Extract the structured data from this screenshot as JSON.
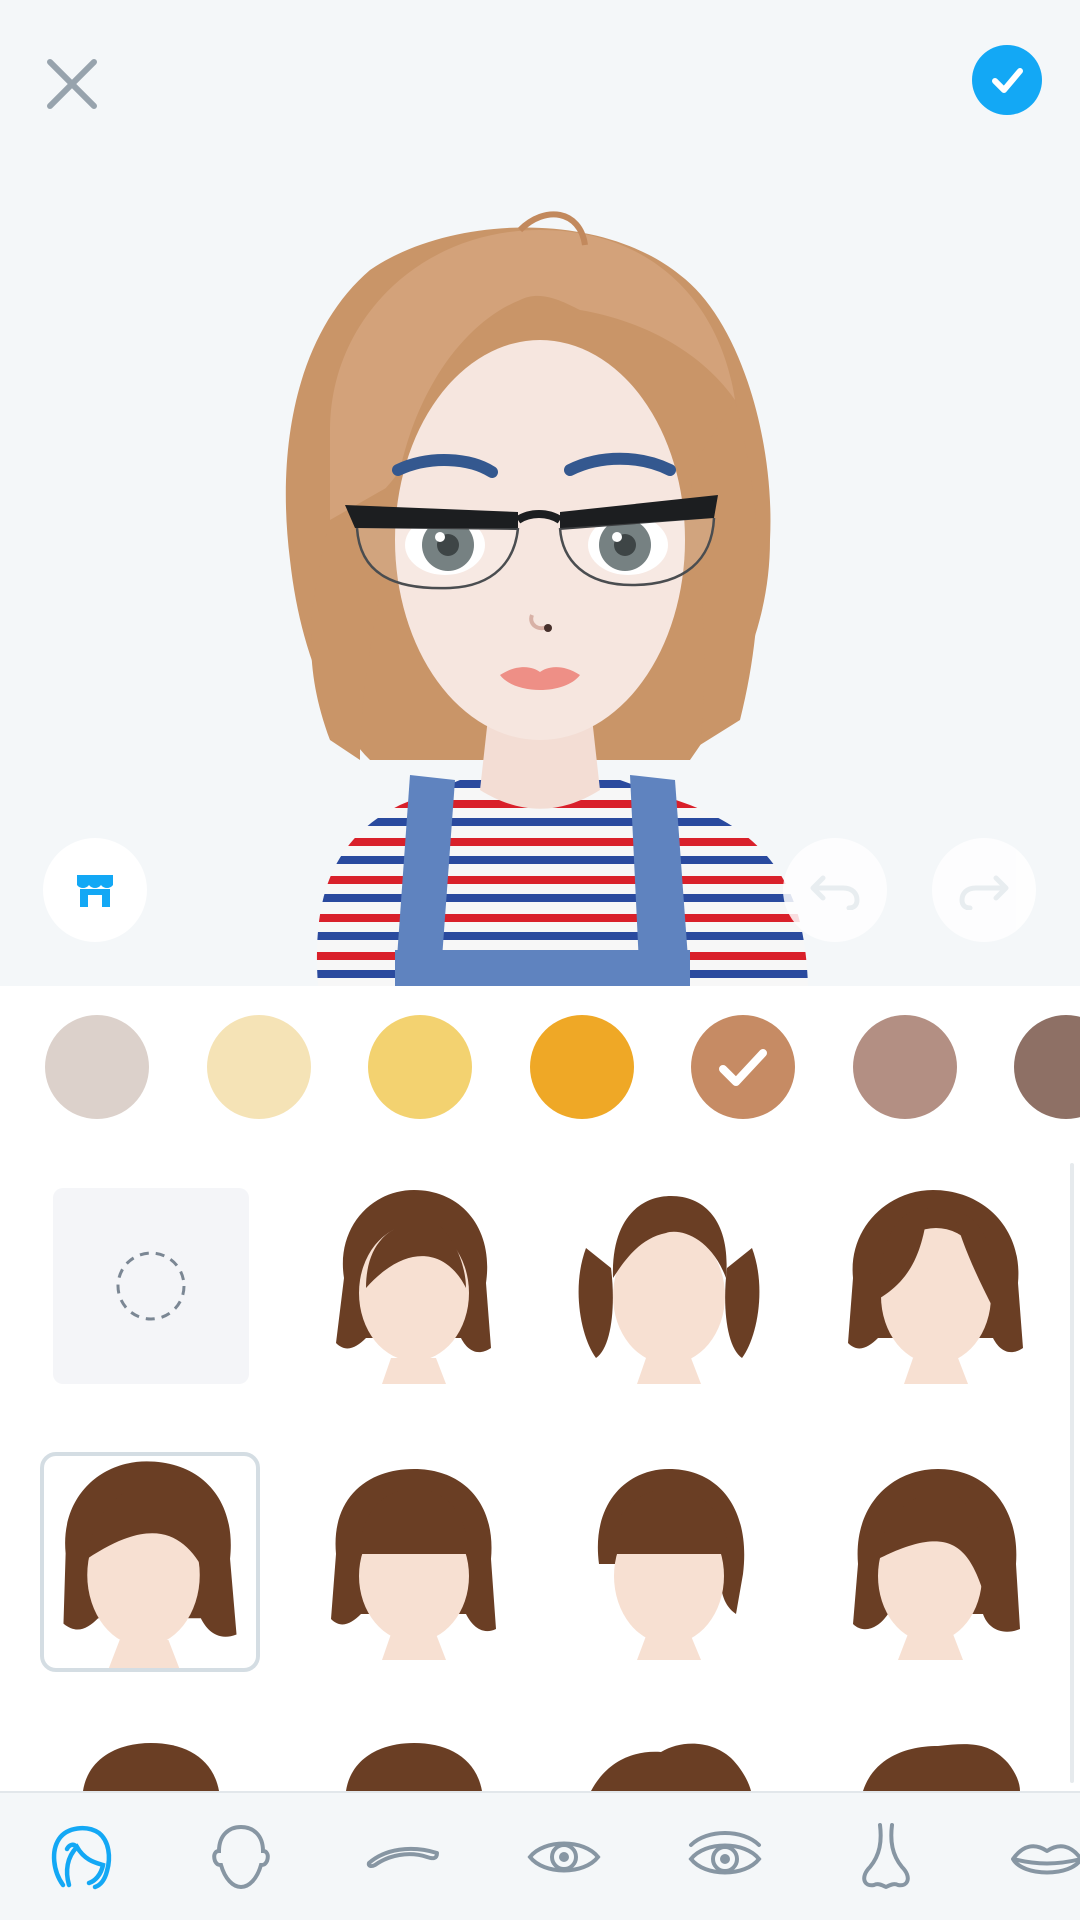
{
  "header": {
    "close_icon": "close-icon",
    "confirm_icon": "checkmark-icon",
    "confirm_color": "#13a8f5"
  },
  "preview": {
    "store_icon": "store-icon",
    "undo_icon": "undo-icon",
    "redo_icon": "redo-icon"
  },
  "hair_colors": [
    {
      "hex": "#dcd1cb",
      "selected": false
    },
    {
      "hex": "#f5e3b6",
      "selected": false
    },
    {
      "hex": "#f3d270",
      "selected": false
    },
    {
      "hex": "#efa826",
      "selected": false
    },
    {
      "hex": "#c68b64",
      "selected": true
    },
    {
      "hex": "#b38f83",
      "selected": false
    },
    {
      "hex": "#8e7065",
      "selected": false
    }
  ],
  "hair_styles": {
    "none_option_icon": "none-dashed-circle-icon",
    "selected_index": 4,
    "hair_color": "#6a3e24"
  },
  "bottom_nav": [
    {
      "icon": "hair-icon",
      "active": true
    },
    {
      "icon": "face-shape-icon",
      "active": false
    },
    {
      "icon": "eyebrow-icon",
      "active": false
    },
    {
      "icon": "eye-icon",
      "active": false
    },
    {
      "icon": "eye-detail-icon",
      "active": false
    },
    {
      "icon": "nose-icon",
      "active": false
    },
    {
      "icon": "lips-icon",
      "active": false
    }
  ]
}
